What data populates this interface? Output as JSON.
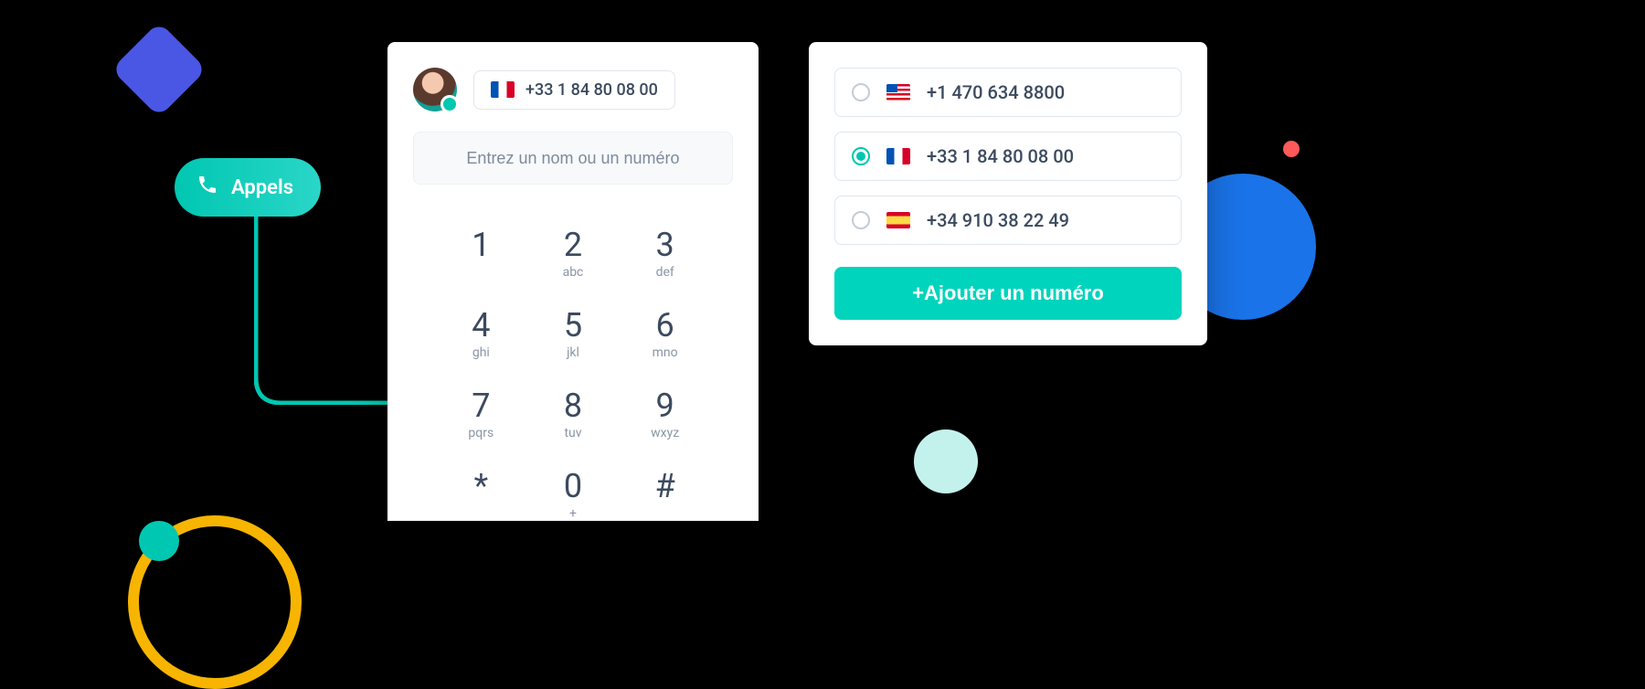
{
  "appels": {
    "label": "Appels"
  },
  "dialer": {
    "current_number": "+33 1 84 80 08 00",
    "current_flag": "fr",
    "search_placeholder": "Entrez un nom ou un numéro",
    "keys": [
      {
        "digit": "1",
        "letters": ""
      },
      {
        "digit": "2",
        "letters": "abc"
      },
      {
        "digit": "3",
        "letters": "def"
      },
      {
        "digit": "4",
        "letters": "ghi"
      },
      {
        "digit": "5",
        "letters": "jkl"
      },
      {
        "digit": "6",
        "letters": "mno"
      },
      {
        "digit": "7",
        "letters": "pqrs"
      },
      {
        "digit": "8",
        "letters": "tuv"
      },
      {
        "digit": "9",
        "letters": "wxyz"
      },
      {
        "digit": "*",
        "letters": ""
      },
      {
        "digit": "0",
        "letters": "+"
      },
      {
        "digit": "#",
        "letters": ""
      }
    ]
  },
  "numbers": {
    "items": [
      {
        "flag": "us",
        "number": "+1 470 634 8800",
        "selected": false
      },
      {
        "flag": "fr",
        "number": "+33 1 84 80 08 00",
        "selected": true
      },
      {
        "flag": "es",
        "number": "+34 910 38 22 49",
        "selected": false
      }
    ],
    "add_label": "+Ajouter un numéro"
  },
  "colors": {
    "teal": "#00c7b1",
    "blue": "#1a73e8",
    "indigo": "#4a57e5",
    "amber": "#f7b500",
    "coral": "#ff5a5a"
  }
}
